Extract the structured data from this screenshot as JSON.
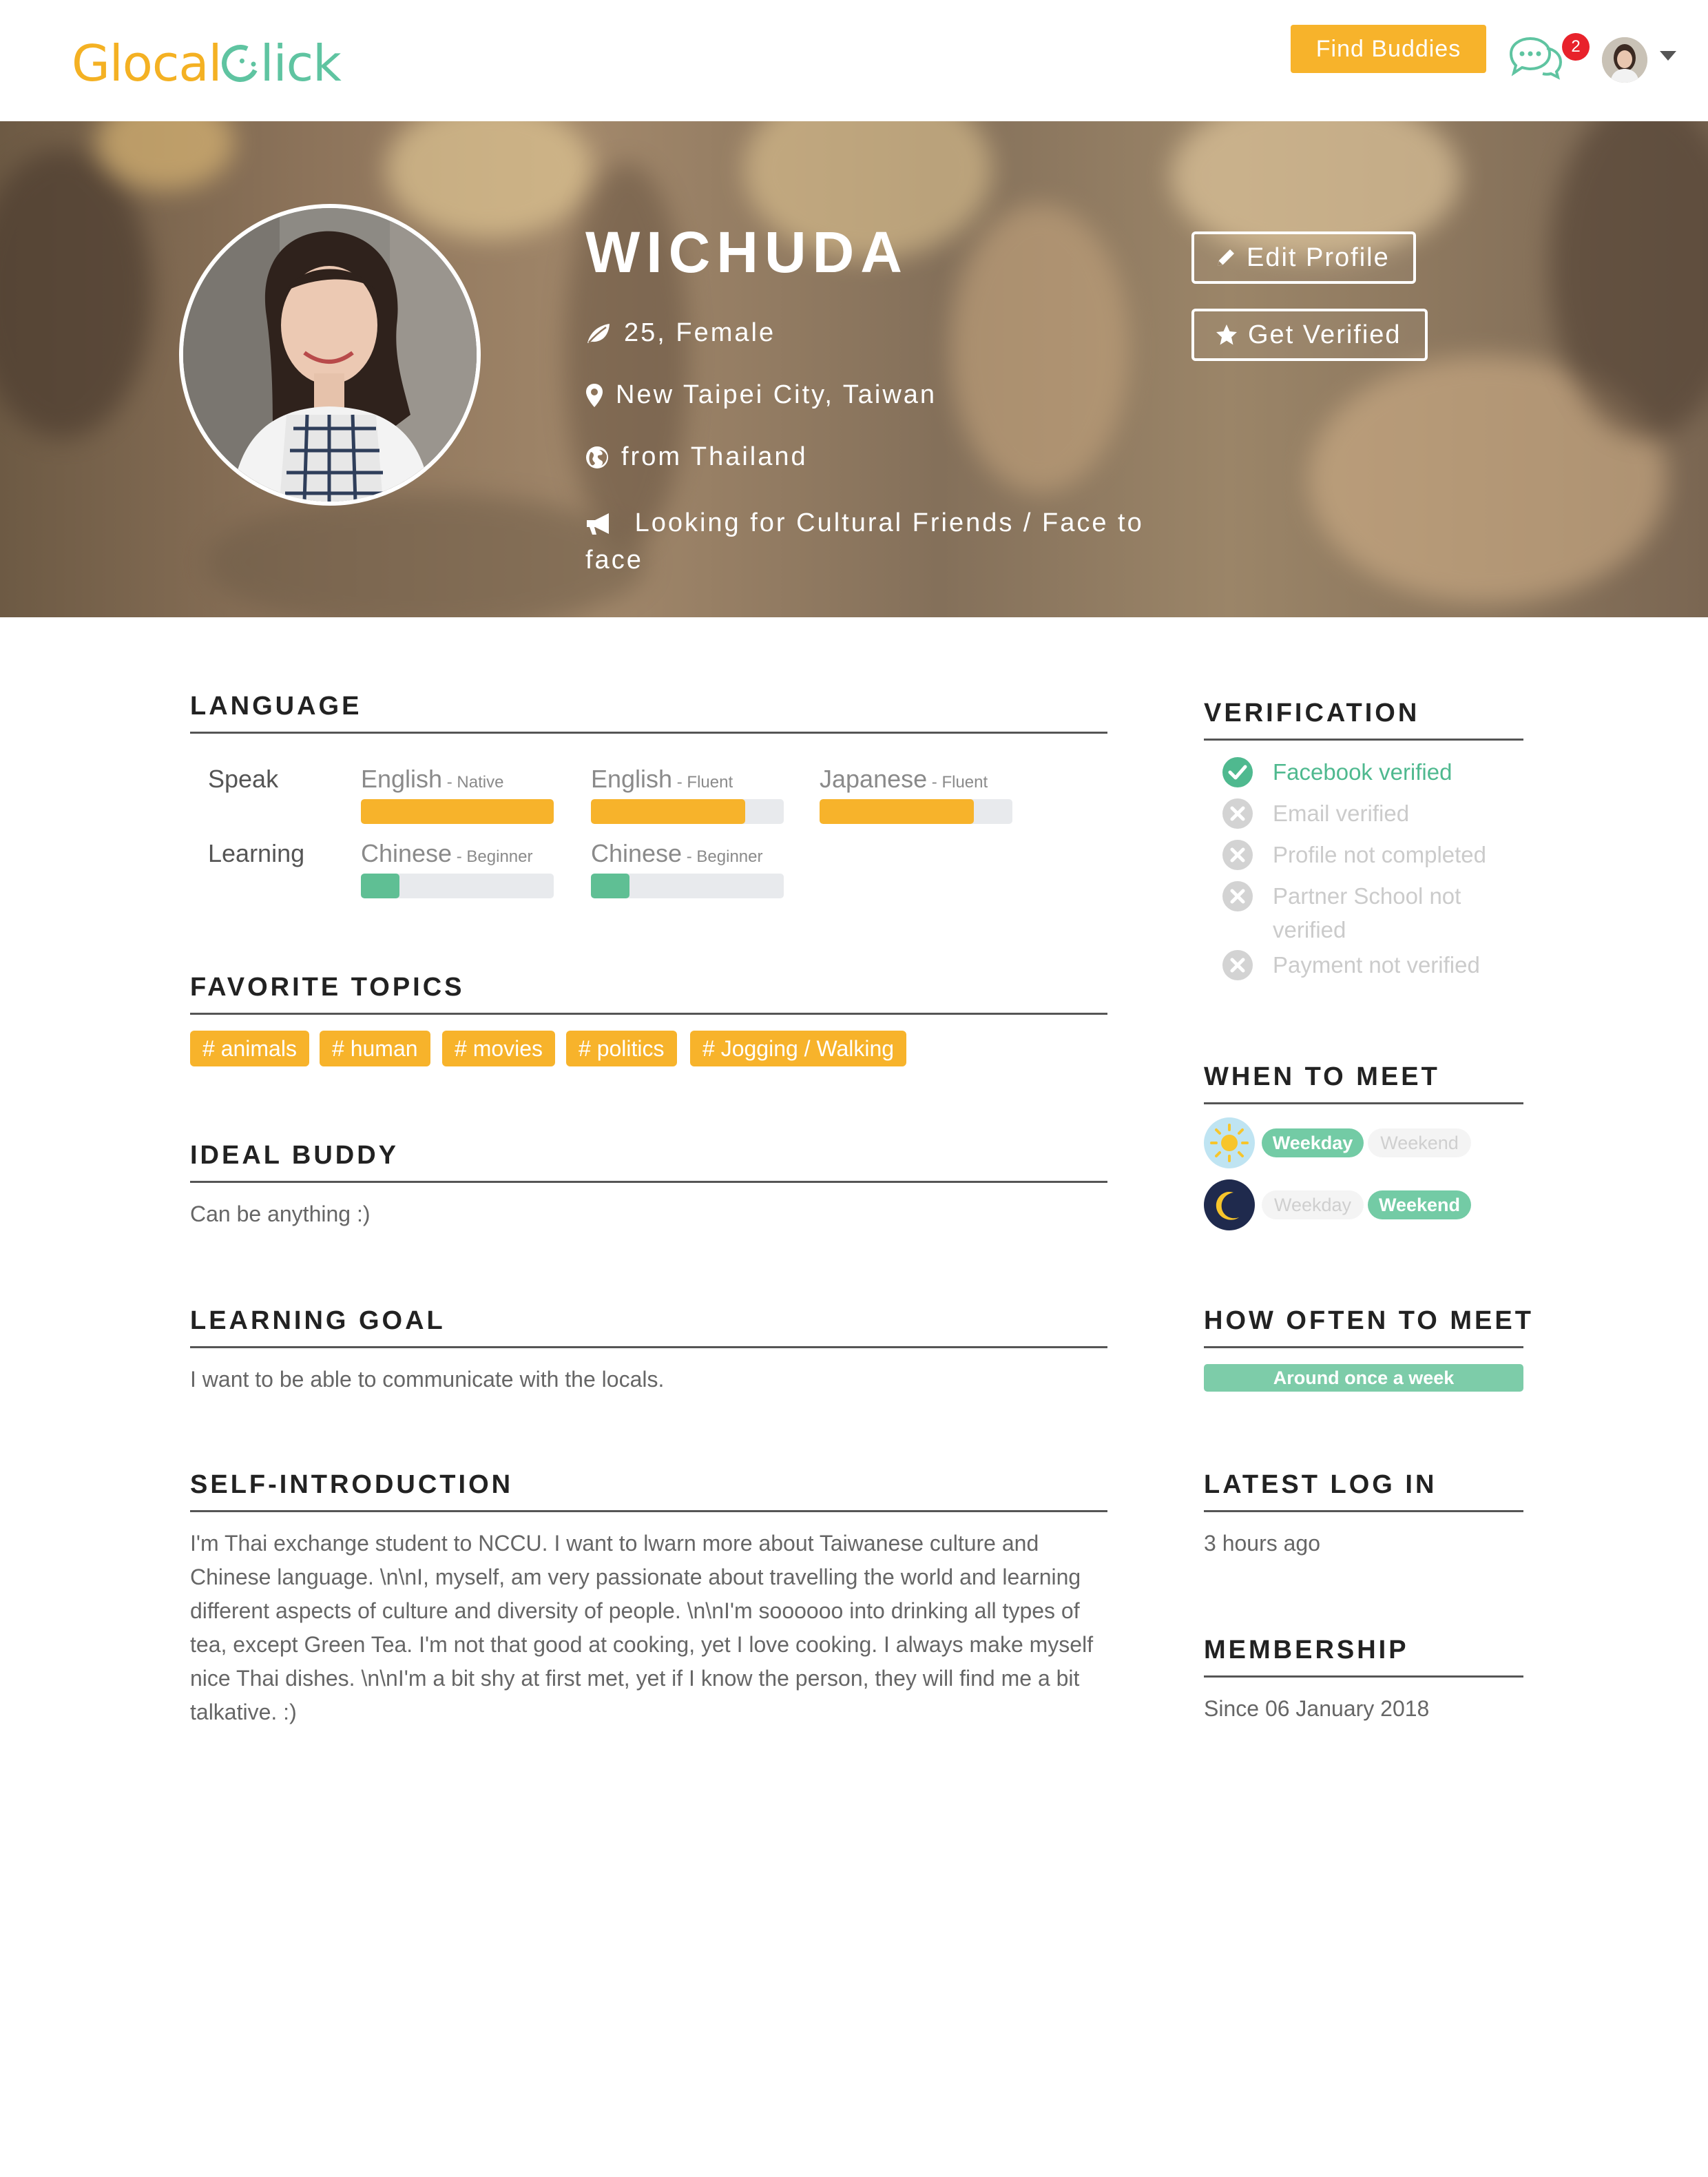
{
  "header": {
    "logo_part1": "Glocal",
    "logo_part2": "lick",
    "find_buddies": "Find Buddies",
    "chat_badge": "2"
  },
  "profile": {
    "name": "WICHUDA",
    "age_gender": "25, Female",
    "location": "New Taipei City, Taiwan",
    "origin": "from Thailand",
    "looking_for": "Looking for Cultural Friends / Face to face",
    "edit_profile": "Edit Profile",
    "get_verified": "Get Verified"
  },
  "language": {
    "title": "LANGUAGE",
    "speak_label": "Speak",
    "learning_label": "Learning",
    "speak": [
      {
        "name": "English",
        "level": " - Native",
        "progress": 1.0,
        "color": "#f7b32b"
      },
      {
        "name": "English",
        "level": " - Fluent",
        "progress": 0.8,
        "color": "#f7b32b"
      },
      {
        "name": "Japanese",
        "level": " - Fluent",
        "progress": 0.8,
        "color": "#f7b32b"
      }
    ],
    "learning": [
      {
        "name": "Chinese",
        "level": " - Beginner",
        "progress": 0.2,
        "color": "#5fbf94"
      },
      {
        "name": "Chinese",
        "level": " - Beginner",
        "progress": 0.2,
        "color": "#5fbf94"
      }
    ]
  },
  "topics": {
    "title": "FAVORITE TOPICS",
    "tags": [
      "# animals",
      "# human",
      "# movies",
      "# politics",
      "# Jogging / Walking"
    ]
  },
  "ideal_buddy": {
    "title": "IDEAL BUDDY",
    "text": "Can be anything :)"
  },
  "learning_goal": {
    "title": "LEARNING GOAL",
    "text": "I want to be able to communicate with the locals."
  },
  "self_intro": {
    "title": "SELF-INTRODUCTION",
    "text": "I'm Thai exchange student to NCCU. I want to lwarn more about Taiwanese culture and Chinese language. \\n\\nI, myself, am very passionate about travelling the world and learning different aspects of culture and diversity of people. \\n\\nI'm soooooo into drinking all types of tea, except Green Tea. I'm not that good at cooking, yet I love cooking. I always make myself nice Thai dishes. \\n\\nI'm a bit shy at first met, yet if I know the person, they will find me a bit talkative. :)"
  },
  "verification": {
    "title": "VERIFICATION",
    "items": [
      {
        "label": "Facebook verified",
        "verified": true
      },
      {
        "label": "Email verified",
        "verified": false
      },
      {
        "label": "Profile not completed",
        "verified": false
      },
      {
        "label": "Partner School not verified",
        "verified": false
      },
      {
        "label": "Payment not verified",
        "verified": false
      }
    ]
  },
  "when_to_meet": {
    "title": "WHEN TO MEET",
    "day": {
      "icon": "sun-icon",
      "weekday": "Weekday",
      "weekend": "Weekend",
      "weekday_on": true,
      "weekend_on": false
    },
    "night": {
      "icon": "moon-icon",
      "weekday": "Weekday",
      "weekend": "Weekend",
      "weekday_on": false,
      "weekend_on": true
    }
  },
  "how_often": {
    "title": "HOW OFTEN TO MEET",
    "value": "Around once a week"
  },
  "latest_login": {
    "title": "LATEST LOG IN",
    "value": "3 hours ago"
  },
  "membership": {
    "title": "MEMBERSHIP",
    "value": "Since 06 January 2018"
  },
  "colors": {
    "accent_yellow": "#f7b32b",
    "accent_green": "#5fc4a1"
  }
}
